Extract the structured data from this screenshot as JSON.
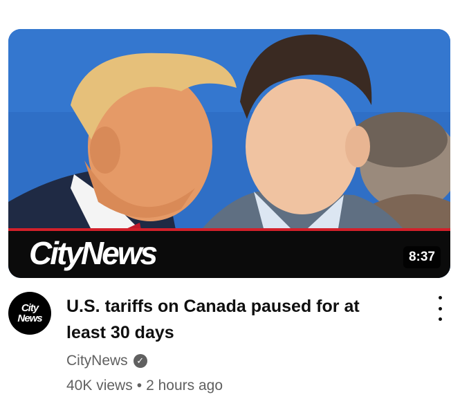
{
  "video": {
    "brand": "CityNews",
    "duration": "8:37",
    "title": "U.S. tariffs on Canada paused for at least 30 days",
    "channel": "CityNews",
    "views": "40K views",
    "separator": "•",
    "age": "2 hours ago",
    "avatar_lines": [
      "City",
      "News"
    ]
  },
  "colors": {
    "thumb_background": "#2f6fc6",
    "brand_bar": "#0b0b0b",
    "brand_stripe": "#d3202a",
    "meta_text": "#606060"
  },
  "icons": {
    "verified": "check-circle",
    "menu": "three-dots-vertical"
  }
}
